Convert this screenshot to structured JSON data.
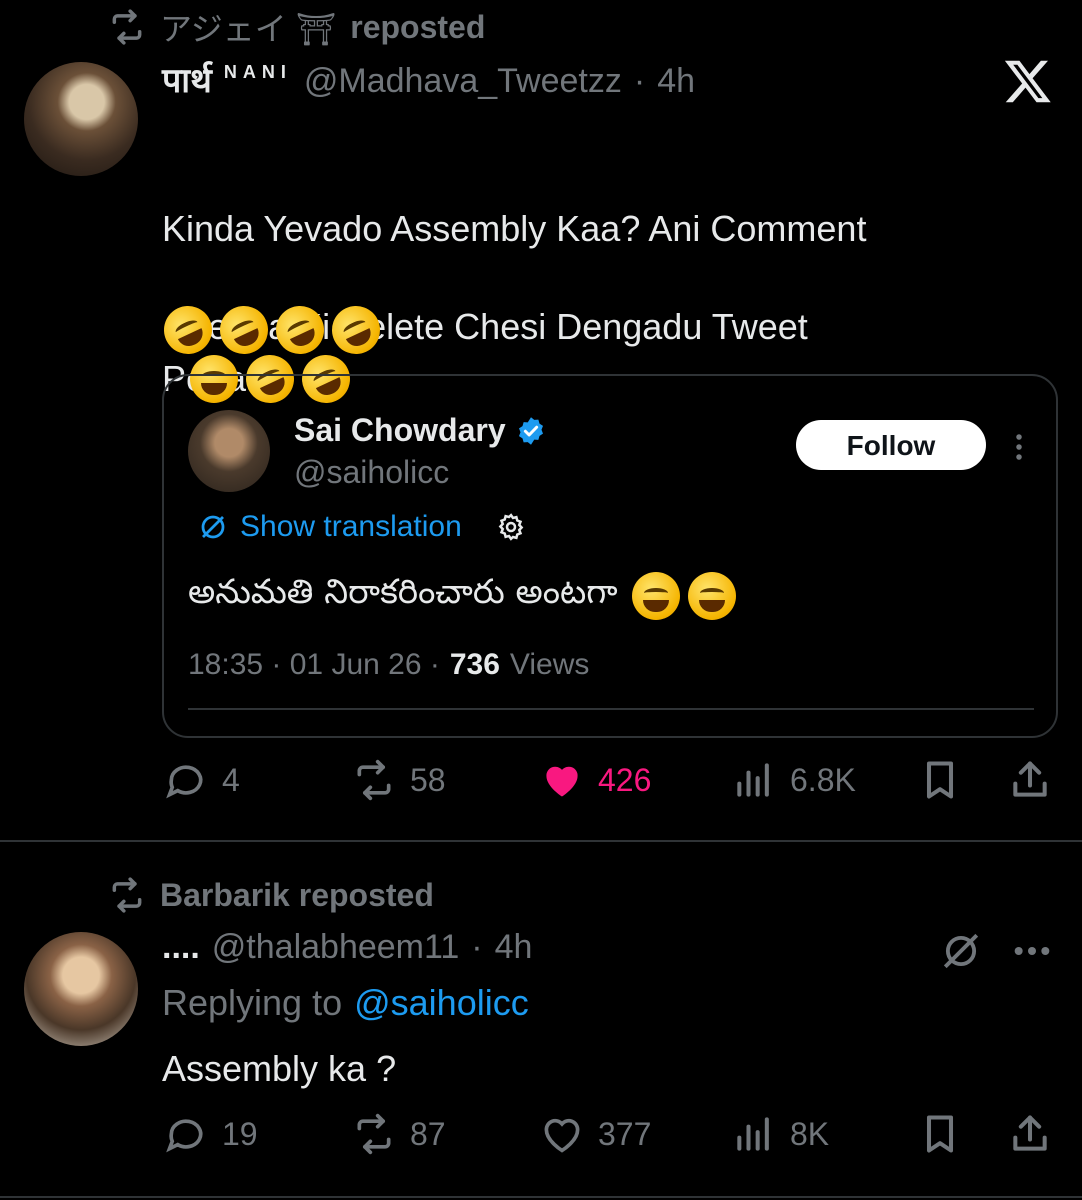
{
  "post1": {
    "repost_user": "アジェイ ⛩",
    "repost_suffix": "reposted",
    "author_name": "पार्थ",
    "author_name_suffix": "NANI",
    "handle": "@Madhava_Tweetzz",
    "time": "4h",
    "text_line1": "Kinda Yevado Assembly Kaa? Ani Comment",
    "text_line2": "Pettadu",
    "text_line3": "Debba Ki Delete Chesi Dengadu Tweet",
    "quote": {
      "name": "Sai Chowdary",
      "handle": "@saiholicc",
      "follow_label": "Follow",
      "translation_label": "Show translation",
      "text": "అనుమతి నిరాకరించారు అంటగా",
      "time": "18:35 · 01 Jun 26 ·",
      "views_count": "736",
      "views_label": "Views"
    },
    "stats": {
      "replies": "4",
      "reposts": "58",
      "likes": "426",
      "views": "6.8K"
    },
    "like_color": "#f91880"
  },
  "post2": {
    "repost_label": "Barbarik reposted",
    "author_name": "....",
    "handle": "@thalabheem11",
    "time": "4h",
    "replying_prefix": "Replying to",
    "replying_handle": "@saiholicc",
    "text": "Assembly ka ?",
    "stats": {
      "replies": "19",
      "reposts": "87",
      "likes": "377",
      "views": "8K"
    }
  },
  "icons": [
    "repost-icon",
    "x-logo-icon",
    "verified-icon",
    "more-icon",
    "translate-icon",
    "gear-icon",
    "reply-icon",
    "like-icon",
    "views-icon",
    "bookmark-icon",
    "share-icon",
    "grok-icon"
  ],
  "accent": "#1d9bf0"
}
